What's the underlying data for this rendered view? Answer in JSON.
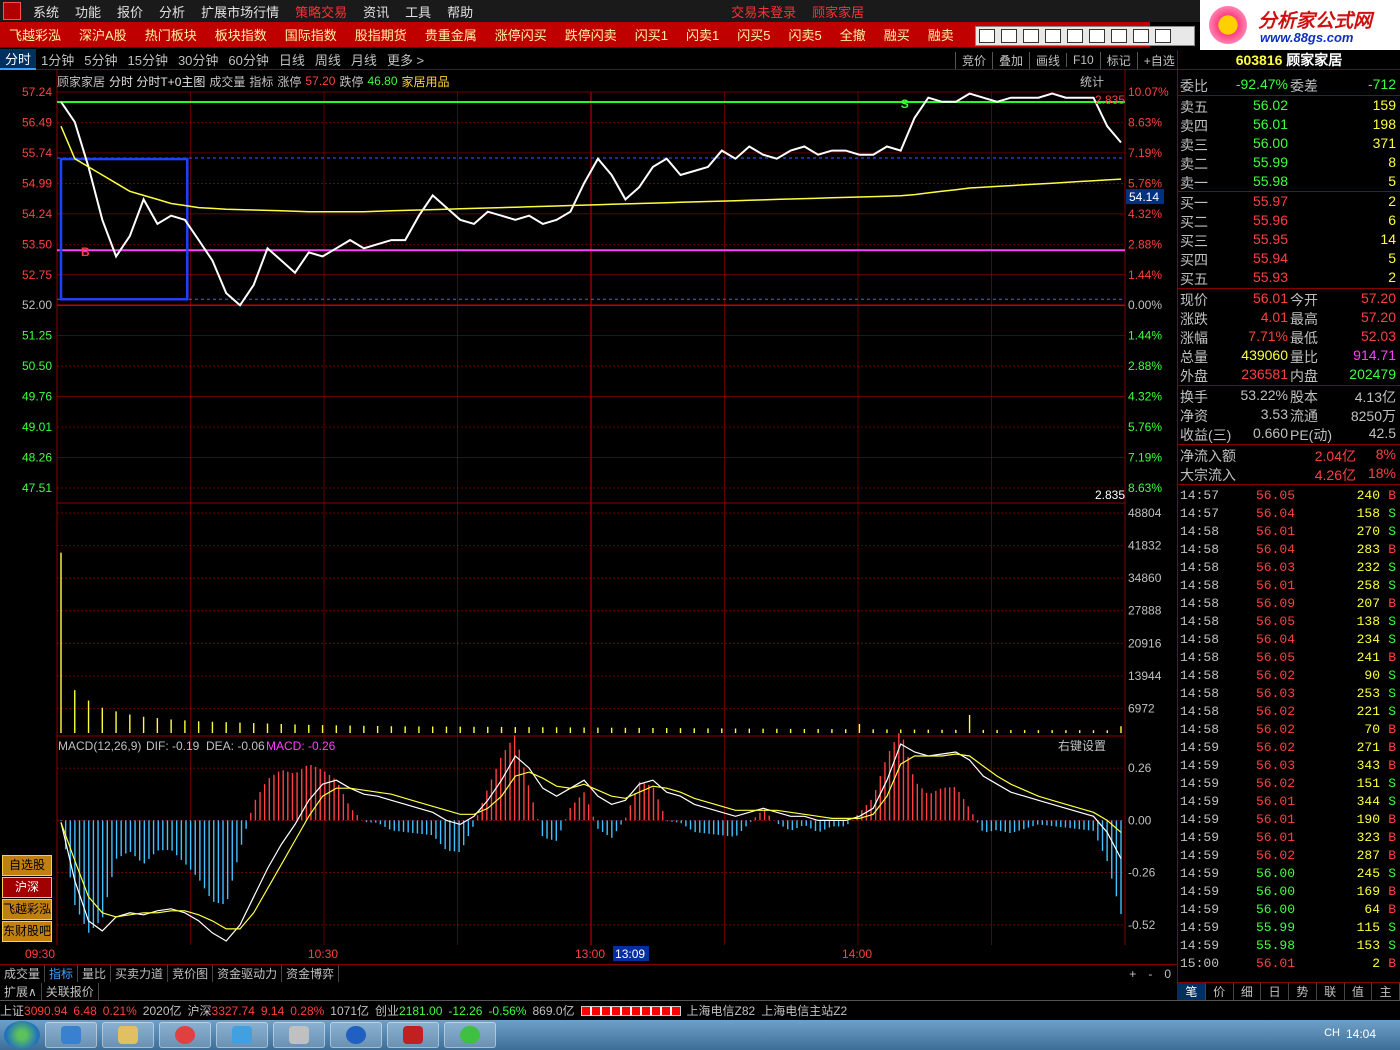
{
  "menu": [
    "系统",
    "功能",
    "报价",
    "分析",
    "扩展市场行情",
    "策略交易",
    "资讯",
    "工具",
    "帮助"
  ],
  "login_status": "交易未登录",
  "stock_name_title": "顾家家居",
  "toolbar": [
    "飞越彩泓",
    "深沪A股",
    "热门板块",
    "板块指数",
    "国际指数",
    "股指期货",
    "贵重金属",
    "涨停闪买",
    "跌停闪卖",
    "闪买1",
    "闪卖1",
    "闪买5",
    "闪卖5",
    "全撤",
    "融买",
    "融卖"
  ],
  "brand": {
    "title": "分析家公式网",
    "url": "www.88gs.com"
  },
  "periods": [
    "分时",
    "1分钟",
    "5分钟",
    "15分钟",
    "30分钟",
    "60分钟",
    "日线",
    "周线",
    "月线",
    "更多 >"
  ],
  "period_right": [
    "竞价",
    "叠加",
    "画线",
    "F10",
    "标记",
    "+自选"
  ],
  "chart_info": {
    "name": "顾家家居",
    "mode": "分时 分时T+0主图",
    "ind1": "成交量",
    "ind2": "指标",
    "limit_up_label": "涨停",
    "limit_up": "57.20",
    "limit_down_label": "跌停",
    "limit_down": "46.80",
    "sector": "家居用品",
    "stat": "统计"
  },
  "chart_data": [
    {
      "type": "line",
      "price_ticks": [
        "57.24",
        "56.49",
        "55.74",
        "54.99",
        "54.24",
        "53.50",
        "52.75",
        "52.00",
        "51.25",
        "50.50",
        "49.76",
        "49.01",
        "48.26",
        "47.51"
      ],
      "pct_ticks": [
        "10.07%",
        "8.63%",
        "7.19%",
        "5.76%",
        "4.32%",
        "2.88%",
        "1.44%",
        "0.00%",
        "1.44%",
        "2.88%",
        "4.32%",
        "5.76%",
        "7.19%",
        "8.63%"
      ],
      "ylim": [
        47.51,
        57.24
      ],
      "prev_close": 52.0,
      "current_price_tag": "54.14",
      "marker_value": "2.835",
      "price": [
        57.0,
        56.5,
        55.4,
        54.1,
        53.2,
        53.7,
        54.6,
        54.0,
        54.2,
        54.1,
        53.6,
        53.1,
        52.3,
        52.0,
        52.5,
        53.4,
        53.1,
        52.8,
        53.3,
        53.2,
        53.4,
        53.6,
        53.4,
        53.5,
        53.6,
        53.6,
        54.2,
        54.7,
        54.4,
        54.1,
        54.0,
        54.3,
        54.2,
        54.1,
        54.2,
        54.0,
        54.1,
        54.3,
        55.0,
        55.6,
        55.2,
        54.6,
        54.9,
        55.4,
        55.6,
        55.2,
        55.3,
        55.4,
        55.8,
        55.6,
        55.9,
        55.7,
        55.6,
        55.8,
        55.9,
        55.7,
        55.8,
        55.8,
        55.7,
        55.7,
        55.9,
        55.8,
        56.6,
        57.1,
        57.0,
        57.0,
        57.2,
        57.1,
        57.0,
        57.1,
        57.1,
        57.1,
        57.2,
        57.1,
        57.1,
        57.1,
        56.4,
        56.0
      ],
      "avg": [
        56.4,
        55.6,
        55.4,
        55.2,
        55.0,
        54.8,
        54.7,
        54.6,
        54.5,
        54.45,
        54.4,
        54.38,
        54.36,
        54.35,
        54.34,
        54.33,
        54.32,
        54.31,
        54.3,
        54.3,
        54.3,
        54.3,
        54.3,
        54.31,
        54.32,
        54.33,
        54.34,
        54.35,
        54.36,
        54.37,
        54.38,
        54.39,
        54.4,
        54.41,
        54.42,
        54.43,
        54.44,
        54.45,
        54.46,
        54.47,
        54.48,
        54.49,
        54.5,
        54.51,
        54.52,
        54.53,
        54.54,
        54.55,
        54.56,
        54.57,
        54.58,
        54.59,
        54.6,
        54.61,
        54.62,
        54.63,
        54.64,
        54.65,
        54.66,
        54.67,
        54.68,
        54.69,
        54.72,
        54.76,
        54.8,
        54.84,
        54.88,
        54.9,
        54.92,
        54.94,
        54.96,
        54.98,
        55.0,
        55.02,
        55.04,
        55.06,
        55.08,
        55.1
      ],
      "volume_ticks": [
        "48804",
        "41832",
        "34860",
        "27888",
        "20916",
        "13944",
        "6972"
      ],
      "volume": [
        40000,
        9500,
        7200,
        5600,
        4800,
        4100,
        3600,
        3300,
        3000,
        2800,
        2600,
        2500,
        2400,
        2300,
        2200,
        2100,
        2000,
        1900,
        1800,
        1750,
        1700,
        1650,
        1600,
        1550,
        1500,
        1480,
        1460,
        1440,
        1420,
        1400,
        1380,
        1360,
        1340,
        1320,
        1300,
        1280,
        1260,
        1240,
        1220,
        1200,
        1180,
        1160,
        1140,
        1120,
        1100,
        1080,
        1060,
        1040,
        1020,
        1000,
        980,
        960,
        940,
        920,
        900,
        880,
        860,
        840,
        2000,
        820,
        800,
        780,
        760,
        740,
        720,
        700,
        4000,
        690,
        680,
        670,
        660,
        650,
        640,
        630,
        620,
        610,
        600,
        1500
      ],
      "macd_label": "MACD(12,26,9)",
      "dif_label": "DIF: -0.19",
      "dea_label": "DEA: -0.06",
      "macd_value_label": "MACD: -0.26",
      "macd_setting": "右键设置",
      "macd_ticks": [
        "0.26",
        "0.00",
        "-0.26",
        "-0.52"
      ],
      "macd_ylim": [
        -0.62,
        0.36
      ],
      "dif": [
        -0.01,
        -0.3,
        -0.5,
        -0.55,
        -0.48,
        -0.46,
        -0.47,
        -0.45,
        -0.44,
        -0.46,
        -0.5,
        -0.56,
        -0.6,
        -0.52,
        -0.38,
        -0.24,
        -0.12,
        -0.02,
        0.1,
        0.18,
        0.2,
        0.16,
        0.13,
        0.12,
        0.1,
        0.08,
        0.06,
        0.04,
        0.0,
        -0.02,
        0.02,
        0.1,
        0.2,
        0.32,
        0.26,
        0.16,
        0.12,
        0.16,
        0.2,
        0.12,
        0.08,
        0.1,
        0.18,
        0.2,
        0.14,
        0.12,
        0.08,
        0.06,
        0.04,
        0.02,
        0.04,
        0.06,
        0.04,
        0.02,
        0.02,
        0.0,
        0.0,
        0.0,
        0.02,
        0.06,
        0.2,
        0.38,
        0.34,
        0.32,
        0.33,
        0.34,
        0.3,
        0.22,
        0.18,
        0.14,
        0.12,
        0.1,
        0.08,
        0.06,
        0.04,
        0.02,
        -0.06,
        -0.19
      ],
      "dea": [
        -0.01,
        -0.2,
        -0.38,
        -0.46,
        -0.48,
        -0.47,
        -0.46,
        -0.46,
        -0.45,
        -0.45,
        -0.47,
        -0.5,
        -0.54,
        -0.54,
        -0.46,
        -0.34,
        -0.22,
        -0.1,
        0.02,
        0.12,
        0.16,
        0.16,
        0.15,
        0.14,
        0.13,
        0.11,
        0.09,
        0.07,
        0.05,
        0.03,
        0.03,
        0.06,
        0.12,
        0.22,
        0.24,
        0.21,
        0.17,
        0.16,
        0.18,
        0.15,
        0.12,
        0.11,
        0.14,
        0.17,
        0.16,
        0.14,
        0.11,
        0.09,
        0.07,
        0.05,
        0.05,
        0.05,
        0.05,
        0.04,
        0.03,
        0.02,
        0.01,
        0.01,
        0.01,
        0.03,
        0.12,
        0.28,
        0.32,
        0.32,
        0.32,
        0.33,
        0.32,
        0.27,
        0.22,
        0.18,
        0.15,
        0.12,
        0.1,
        0.08,
        0.06,
        0.04,
        0.0,
        -0.06
      ],
      "time_ticks": [
        "09:30",
        "10:30",
        "13:00",
        "13:09",
        "14:00"
      ],
      "time_tick_colors": [
        "#ff4040",
        "#ff4040",
        "#ff4040",
        "#ffffff",
        "#ff4040"
      ]
    }
  ],
  "left_buttons": [
    "自选股",
    "沪深",
    "飞越彩泓",
    "东财股吧"
  ],
  "bottom_tabs": [
    "成交量",
    "指标",
    "量比",
    "买卖力道",
    "竞价图",
    "资金驱动力",
    "资金博弈"
  ],
  "bottom_tabs2": [
    "扩展∧",
    "关联报价"
  ],
  "bottom_right_ctrl": [
    "+",
    "-",
    "0"
  ],
  "right_panel": {
    "code": "603816",
    "name": "顾家家居",
    "weibi": {
      "label": "委比",
      "value": "-92.47%",
      "label2": "委差",
      "value2": "-712"
    },
    "sells": [
      {
        "label": "卖五",
        "price": "56.02",
        "vol": "159"
      },
      {
        "label": "卖四",
        "price": "56.01",
        "vol": "198"
      },
      {
        "label": "卖三",
        "price": "56.00",
        "vol": "371"
      },
      {
        "label": "卖二",
        "price": "55.99",
        "vol": "8"
      },
      {
        "label": "卖一",
        "price": "55.98",
        "vol": "5"
      }
    ],
    "buys": [
      {
        "label": "买一",
        "price": "55.97",
        "vol": "2"
      },
      {
        "label": "买二",
        "price": "55.96",
        "vol": "6"
      },
      {
        "label": "买三",
        "price": "55.95",
        "vol": "14"
      },
      {
        "label": "买四",
        "price": "55.94",
        "vol": "5"
      },
      {
        "label": "买五",
        "price": "55.93",
        "vol": "2"
      }
    ],
    "quotes": [
      {
        "l1": "现价",
        "v1": "56.01",
        "c1": "#ff4040",
        "l2": "今开",
        "v2": "57.20",
        "c2": "#ff4040"
      },
      {
        "l1": "涨跌",
        "v1": "4.01",
        "c1": "#ff4040",
        "l2": "最高",
        "v2": "57.20",
        "c2": "#ff4040"
      },
      {
        "l1": "涨幅",
        "v1": "7.71%",
        "c1": "#ff4040",
        "l2": "最低",
        "v2": "52.03",
        "c2": "#ff4040"
      },
      {
        "l1": "总量",
        "v1": "439060",
        "c1": "#ffff40",
        "l2": "量比",
        "v2": "914.71",
        "c2": "#ff40ff"
      },
      {
        "l1": "外盘",
        "v1": "236581",
        "c1": "#ff4040",
        "l2": "内盘",
        "v2": "202479",
        "c2": "#40ff40"
      }
    ],
    "funds": [
      {
        "l1": "换手",
        "v1": "53.22%",
        "c1": "#c0c0c0",
        "l2": "股本",
        "v2": "4.13亿",
        "c2": "#c0c0c0"
      },
      {
        "l1": "净资",
        "v1": "3.53",
        "c1": "#c0c0c0",
        "l2": "流通",
        "v2": "8250万",
        "c2": "#c0c0c0"
      },
      {
        "l1": "收益(三)",
        "v1": "0.660",
        "c1": "#c0c0c0",
        "l2": "PE(动)",
        "v2": "42.5",
        "c2": "#c0c0c0"
      }
    ],
    "flow": [
      {
        "label": "净流入额",
        "value": "2.04亿",
        "pct": "8%"
      },
      {
        "label": "大宗流入",
        "value": "4.26亿",
        "pct": "18%"
      }
    ],
    "trades": [
      [
        "14:57",
        "56.05",
        "240",
        "B"
      ],
      [
        "14:57",
        "56.04",
        "158",
        "S"
      ],
      [
        "14:58",
        "56.01",
        "270",
        "S"
      ],
      [
        "14:58",
        "56.04",
        "283",
        "B"
      ],
      [
        "14:58",
        "56.03",
        "232",
        "S"
      ],
      [
        "14:58",
        "56.01",
        "258",
        "S"
      ],
      [
        "14:58",
        "56.09",
        "207",
        "B"
      ],
      [
        "14:58",
        "56.05",
        "138",
        "S"
      ],
      [
        "14:58",
        "56.04",
        "234",
        "S"
      ],
      [
        "14:58",
        "56.05",
        "241",
        "B"
      ],
      [
        "14:58",
        "56.02",
        "90",
        "S"
      ],
      [
        "14:58",
        "56.03",
        "253",
        "S"
      ],
      [
        "14:58",
        "56.02",
        "221",
        "S"
      ],
      [
        "14:58",
        "56.02",
        "70",
        "B"
      ],
      [
        "14:59",
        "56.02",
        "271",
        "B"
      ],
      [
        "14:59",
        "56.03",
        "343",
        "B"
      ],
      [
        "14:59",
        "56.02",
        "151",
        "S"
      ],
      [
        "14:59",
        "56.01",
        "344",
        "S"
      ],
      [
        "14:59",
        "56.01",
        "190",
        "B"
      ],
      [
        "14:59",
        "56.01",
        "323",
        "B"
      ],
      [
        "14:59",
        "56.02",
        "287",
        "B"
      ],
      [
        "14:59",
        "56.00",
        "245",
        "S"
      ],
      [
        "14:59",
        "56.00",
        "169",
        "B"
      ],
      [
        "14:59",
        "56.00",
        "64",
        "B"
      ],
      [
        "14:59",
        "55.99",
        "115",
        "S"
      ],
      [
        "14:59",
        "55.98",
        "153",
        "S"
      ],
      [
        "15:00",
        "56.01",
        "2",
        "B"
      ]
    ],
    "tabs": [
      "笔",
      "价",
      "细",
      "日",
      "势",
      "联",
      "值",
      "主"
    ]
  },
  "statusbar": {
    "sh_label": "上证",
    "sh_value": "3090.94",
    "sh_chg": "6.48",
    "sh_pct": "0.21%",
    "sh_amt": "2020亿",
    "hs_label": "沪深",
    "hs_value": "3327.74",
    "hs_chg": "9.14",
    "hs_pct": "0.28%",
    "hs_amt": "1071亿",
    "cy_label": "创业",
    "cy_value": "2181.00",
    "cy_chg": "-12.26",
    "cy_pct": "-0.56%",
    "cy_amt": "869.0亿",
    "server1": "上海电信Z82",
    "server2": "上海电信主站Z2"
  },
  "taskbar": {
    "lang": "CH",
    "clock": "14:04"
  }
}
